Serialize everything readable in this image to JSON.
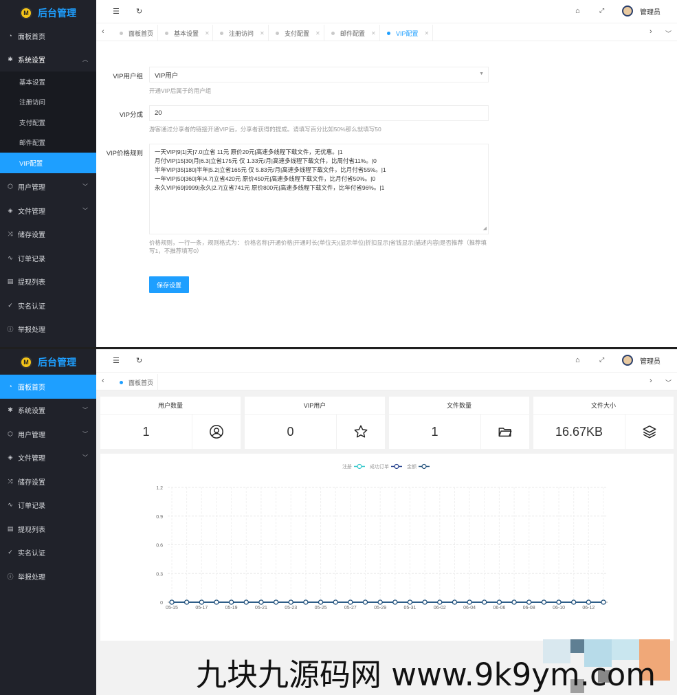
{
  "app": {
    "logo_text": "后台管理",
    "logo_badge": "M"
  },
  "header": {
    "user_name": "管理员"
  },
  "sidebar_top": {
    "items": [
      {
        "label": "面板首页"
      },
      {
        "label": "系统设置",
        "sub": [
          "基本设置",
          "注册访问",
          "支付配置",
          "邮件配置",
          "VIP配置"
        ]
      },
      {
        "label": "用户管理"
      },
      {
        "label": "文件管理"
      },
      {
        "label": "储存设置"
      },
      {
        "label": "订单记录"
      },
      {
        "label": "提现列表"
      },
      {
        "label": "实名认证"
      },
      {
        "label": "举报处理"
      }
    ]
  },
  "tabs_top": [
    "面板首页",
    "基本设置",
    "注册访问",
    "支付配置",
    "邮件配置",
    "VIP配置"
  ],
  "form": {
    "vip_group": {
      "label": "VIP用户组",
      "value": "VIP用户",
      "hint": "开通VIP后属于的用户组"
    },
    "vip_share": {
      "label": "VIP分成",
      "value": "20",
      "hint": "游客通过分享者的链接开通VIP后，分享者获得的提成。请填写百分比如50%那么就填写50"
    },
    "vip_rules": {
      "label": "VIP价格规则",
      "value": "一天VIP|9|1|天|7.0|立省 11元 原价20元|高速多线程下载文件，无优惠。|1\n月付VIP|15|30|月|6.3|立省175元 仅 1.33元/月|高速多线程下载文件，比周付省11%。|0\n半年VIP|35|180|半年|5.2|立省165元 仅 5.83元/月|高速多线程下载文件，比月付省55%。|1\n一年VIP|50|360|年|4.7|立省420元 原价450元|高速多线程下载文件，比月付省50%。|0\n永久VIP|69|9999|永久|2.7|立省741元 原价800元|高速多线程下载文件，比年付省96%。|1",
      "hint": "价格规则，一行一条，规则格式为：  价格名称|开通价格|开通时长(单位天)|显示单位|折扣显示|省钱显示|描述内容|是否推荐（推荐填写1，不推荐填写0）"
    },
    "save_label": "保存设置"
  },
  "sidebar_bottom": {
    "items": [
      "面板首页",
      "系统设置",
      "用户管理",
      "文件管理",
      "储存设置",
      "订单记录",
      "提现列表",
      "实名认证",
      "举报处理"
    ]
  },
  "tabs_bottom": [
    "面板首页"
  ],
  "cards": [
    {
      "title": "用户数量",
      "value": "1",
      "icon": "user-circle-icon"
    },
    {
      "title": "VIP用户",
      "value": "0",
      "icon": "star-icon"
    },
    {
      "title": "文件数量",
      "value": "1",
      "icon": "folder-icon"
    },
    {
      "title": "文件大小",
      "value": "16.67KB",
      "icon": "layers-icon"
    }
  ],
  "chart_data": {
    "type": "line",
    "legend": [
      "注册",
      "成功订单",
      "金额"
    ],
    "colors": {
      "注册": "#2ec7c9",
      "成功订单": "#1e3a8a",
      "金额": "#1f4e79"
    },
    "legend_position": "top-center",
    "x": [
      "05-15",
      "05-16",
      "05-17",
      "05-18",
      "05-19",
      "05-20",
      "05-21",
      "05-22",
      "05-23",
      "05-24",
      "05-25",
      "05-26",
      "05-27",
      "05-28",
      "05-29",
      "05-30",
      "05-31",
      "06-01",
      "06-02",
      "06-03",
      "06-04",
      "06-05",
      "06-06",
      "06-07",
      "06-08",
      "06-09",
      "06-10",
      "06-11",
      "06-12",
      "06-13"
    ],
    "x_tick_labels": [
      "05-15",
      "05-17",
      "05-19",
      "05-21",
      "05-23",
      "05-25",
      "05-27",
      "05-29",
      "05-31",
      "06-02",
      "06-04",
      "06-06",
      "06-08",
      "06-10",
      "06-12"
    ],
    "series": [
      {
        "name": "注册",
        "values": [
          0,
          0,
          0,
          0,
          0,
          0,
          0,
          0,
          0,
          0,
          0,
          0,
          0,
          0,
          0,
          0,
          0,
          0,
          0,
          0,
          0,
          0,
          0,
          0,
          0,
          0,
          0,
          0,
          0,
          0
        ]
      },
      {
        "name": "成功订单",
        "values": [
          0,
          0,
          0,
          0,
          0,
          0,
          0,
          0,
          0,
          0,
          0,
          0,
          0,
          0,
          0,
          0,
          0,
          0,
          0,
          0,
          0,
          0,
          0,
          0,
          0,
          0,
          0,
          0,
          0,
          0
        ]
      },
      {
        "name": "金额",
        "values": [
          0,
          0,
          0,
          0,
          0,
          0,
          0,
          0,
          0,
          0,
          0,
          0,
          0,
          0,
          0,
          0,
          0,
          0,
          0,
          0,
          0,
          0,
          0,
          0,
          0,
          0,
          0,
          0,
          0,
          0
        ]
      }
    ],
    "y_ticks": [
      "0",
      "0.3",
      "0.6",
      "0.9",
      "1.2"
    ],
    "ylim": [
      0,
      1.2
    ],
    "grid": true
  },
  "watermark": "九块九源码网 www.9k9ym.com"
}
